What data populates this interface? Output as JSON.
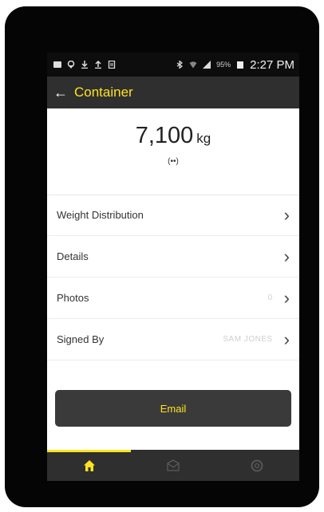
{
  "status_bar": {
    "time": "2:27 PM",
    "battery_percent": "95%",
    "icons": [
      "message-icon",
      "location-icon",
      "download-icon",
      "upload-icon",
      "document-icon",
      "bluetooth-icon",
      "wifi-icon",
      "signal-icon",
      "battery-icon"
    ]
  },
  "header": {
    "title": "Container",
    "back_icon": "back-arrow-icon"
  },
  "weight": {
    "value": "7,100",
    "unit": "kg",
    "icon": "broadcast-signal-icon"
  },
  "rows": [
    {
      "label": "Weight Distribution",
      "value": ""
    },
    {
      "label": "Details",
      "value": ""
    },
    {
      "label": "Photos",
      "value": "0"
    },
    {
      "label": "Signed By",
      "value": "SAM JONES"
    }
  ],
  "email_button": {
    "label": "Email"
  },
  "bottom_nav": {
    "active_index": 0,
    "tabs": [
      {
        "icon": "home-icon"
      },
      {
        "icon": "mail-icon"
      },
      {
        "icon": "settings-icon"
      }
    ]
  },
  "colors": {
    "accent": "#ffe21f",
    "bar": "#2f2f2f"
  }
}
